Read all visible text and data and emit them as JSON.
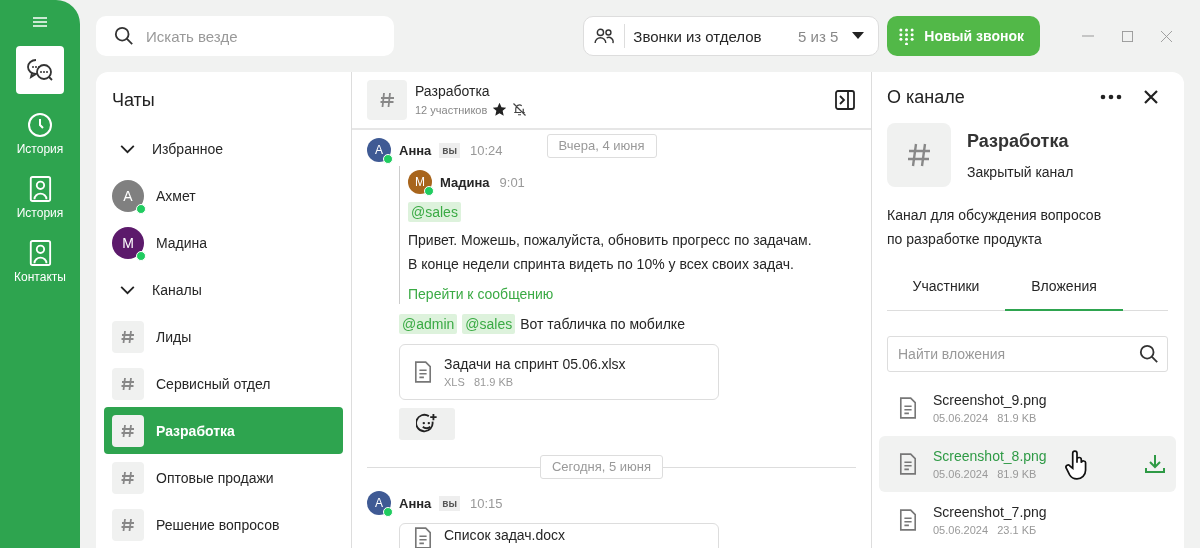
{
  "rail": {
    "items": [
      {
        "kind": "chats",
        "selected": true
      },
      {
        "kind": "history",
        "label": "История",
        "selected": false
      },
      {
        "kind": "contacts",
        "label": "История",
        "selected": false
      },
      {
        "kind": "contacts",
        "label": "Контакты",
        "selected": false
      }
    ]
  },
  "search": {
    "placeholder": "Искать везде"
  },
  "call_filter": {
    "label": "Звонки из отделов",
    "count": "5 из 5"
  },
  "new_call_button": "Новый звонок",
  "chats": {
    "title": "Чаты",
    "groups": [
      {
        "label": "Избранное",
        "expanded": true,
        "items": [
          {
            "kind": "person",
            "name": "Ахмет",
            "initial": "А",
            "color": "#808080",
            "online": true,
            "selected": false
          },
          {
            "kind": "person",
            "name": "Мадина",
            "initial": "М",
            "color": "#5c1a6b",
            "online": true,
            "selected": false
          }
        ]
      },
      {
        "label": "Каналы",
        "expanded": true,
        "items": [
          {
            "kind": "channel",
            "name": "Лиды",
            "selected": false
          },
          {
            "kind": "channel",
            "name": "Сервисный отдел",
            "selected": false
          },
          {
            "kind": "channel",
            "name": "Разработка",
            "selected": true
          },
          {
            "kind": "channel",
            "name": "Оптовые продажи",
            "selected": false
          },
          {
            "kind": "channel",
            "name": "Решение вопросов",
            "selected": false
          }
        ]
      }
    ]
  },
  "channel": {
    "name": "Разработка",
    "members": "12 участников",
    "starred": true,
    "muted": true
  },
  "messages": [
    {
      "kind": "date",
      "label": "Вчера, 4 июня"
    },
    {
      "kind": "message",
      "author": "Анна",
      "initial": "А",
      "color": "#3f5a94",
      "online": true,
      "badge": "вы",
      "time": "10:24",
      "quote": {
        "author": "Мадина",
        "initial": "М",
        "color": "#a8651c",
        "online": true,
        "time": "9:01",
        "mentions": [
          "@sales"
        ],
        "lines": [
          "Привет. Можешь, пожалуйста, обновить прогресс по задачам.",
          "В конце недели спринта видеть по 10% у всех своих задач."
        ],
        "link": "Перейти к сообщению"
      },
      "mentions": [
        "@admin",
        "@sales"
      ],
      "text": "Вот табличка по мобилке",
      "file": {
        "name": "Задачи на спринт 05.06.xlsx",
        "type": "XLS",
        "size": "81.9 KB"
      },
      "reaction_button": true
    },
    {
      "kind": "date",
      "label": "Сегодня, 5 июня"
    },
    {
      "kind": "message",
      "author": "Анна",
      "initial": "А",
      "color": "#3f5a94",
      "online": true,
      "badge": "вы",
      "time": "10:15",
      "file": {
        "name": "Список задач.docx"
      }
    }
  ],
  "info": {
    "title": "О канале",
    "name": "Разработка",
    "type": "Закрытый канал",
    "description": [
      "Канал для обсуждения вопросов",
      "по разработке продукта"
    ],
    "tabs": [
      {
        "label": "Участники",
        "selected": false
      },
      {
        "label": "Вложения",
        "selected": true
      }
    ],
    "search": {
      "placeholder": "Найти вложения"
    },
    "attachments": [
      {
        "name": "Screenshot_9.png",
        "date": "05.06.2024",
        "size": "81.9 KB",
        "hovered": false
      },
      {
        "name": "Screenshot_8.png",
        "date": "05.06.2024",
        "size": "81.9 KB",
        "hovered": true
      },
      {
        "name": "Screenshot_7.png",
        "date": "05.06.2024",
        "size": "23.1 KБ",
        "hovered": false
      }
    ]
  }
}
